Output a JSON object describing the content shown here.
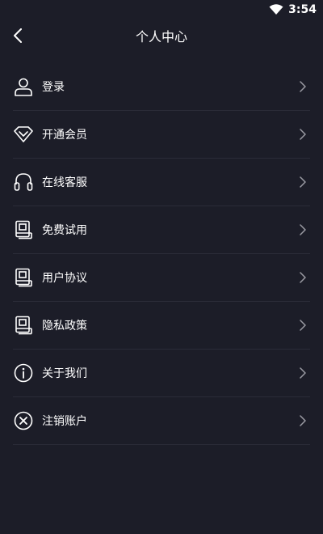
{
  "status_bar": {
    "time": "3:54",
    "wifi_icon": "wifi-icon"
  },
  "nav": {
    "back_icon": "chevron-left-icon",
    "title": "个人中心"
  },
  "menu": {
    "items": [
      {
        "label": "登录",
        "icon": "user-icon"
      },
      {
        "label": "开通会员",
        "icon": "diamond-icon"
      },
      {
        "label": "在线客服",
        "icon": "headset-icon"
      },
      {
        "label": "免费试用",
        "icon": "document-icon"
      },
      {
        "label": "用户协议",
        "icon": "document-icon"
      },
      {
        "label": "隐私政策",
        "icon": "document-icon"
      },
      {
        "label": "关于我们",
        "icon": "info-icon"
      },
      {
        "label": "注销账户",
        "icon": "close-circle-icon"
      }
    ],
    "chevron_icon": "chevron-right-icon"
  },
  "colors": {
    "background": "#1c1d28",
    "divider": "#2b2c38",
    "text": "#ffffff",
    "chevron": "#9a9ba3"
  }
}
